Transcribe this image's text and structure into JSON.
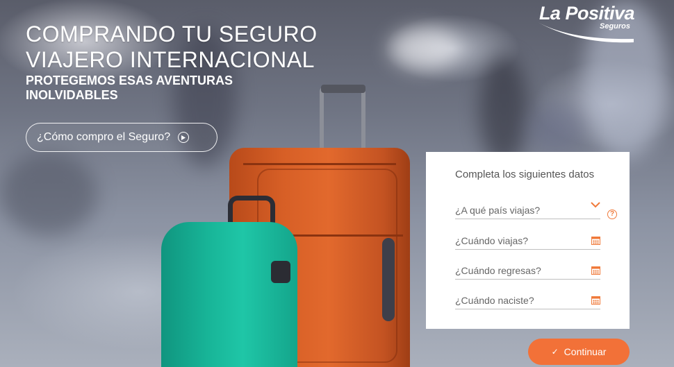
{
  "brand": {
    "name": "La Positiva",
    "sub": "Seguros"
  },
  "hero": {
    "title": "COMPRANDO TU SEGURO VIAJERO INTERNACIONAL",
    "subtitle": "PROTEGEMOS ESAS AVENTURAS INOLVIDABLES",
    "how_button_label": "¿Cómo compro el Seguro?"
  },
  "form": {
    "title": "Completa los siguientes datos",
    "fields": [
      {
        "placeholder": "¿A qué país viajas?",
        "icon": "chevron-down-icon"
      },
      {
        "placeholder": "¿Cuándo viajas?",
        "icon": "calendar-icon"
      },
      {
        "placeholder": "¿Cuándo regresas?",
        "icon": "calendar-icon"
      },
      {
        "placeholder": "¿Cuándo naciste?",
        "icon": "calendar-icon"
      }
    ],
    "help_icon": "question-icon",
    "continue_label": "Continuar"
  },
  "colors": {
    "accent": "#f27138",
    "text_muted": "#666666",
    "white": "#ffffff"
  }
}
